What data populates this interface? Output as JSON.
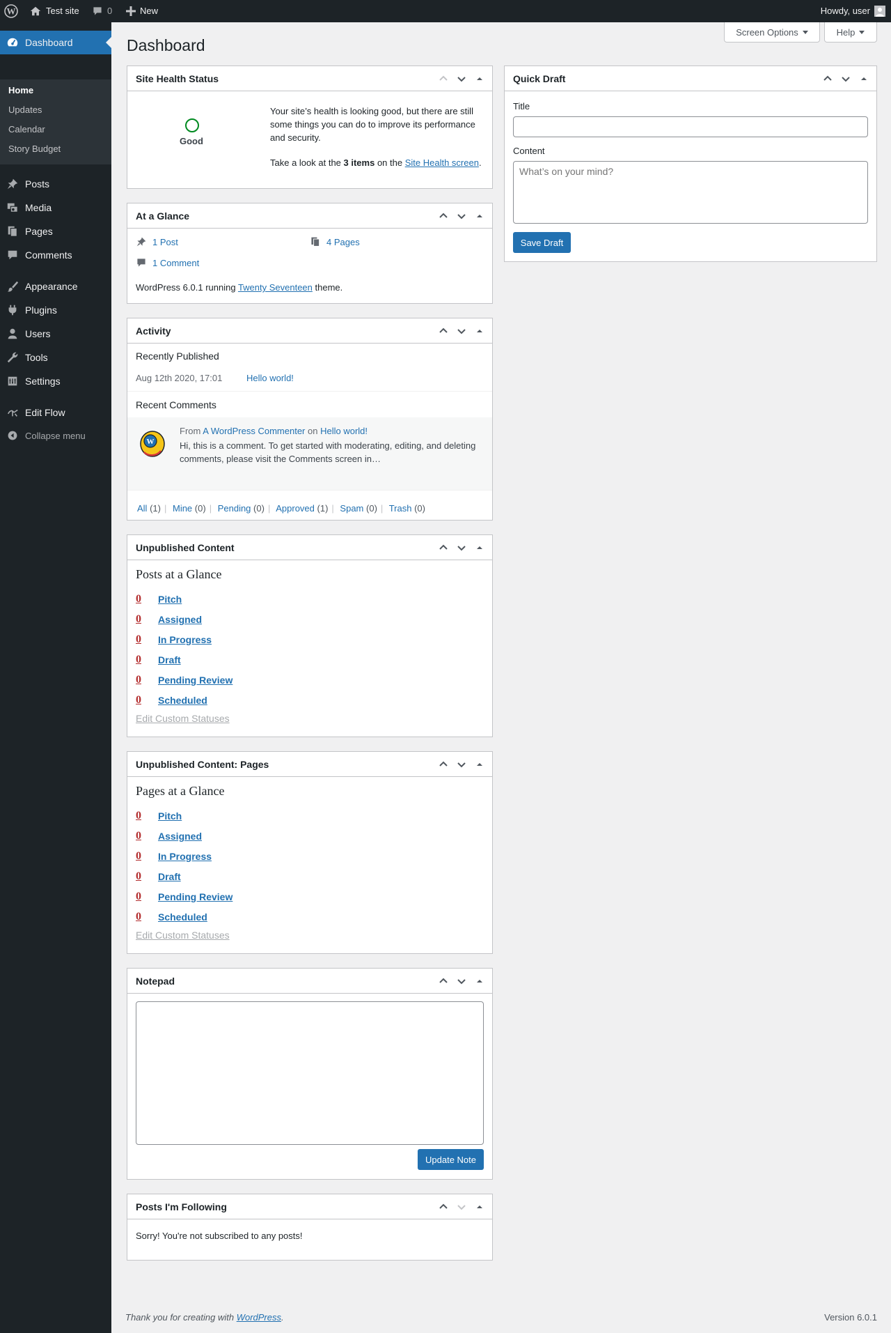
{
  "adminbar": {
    "site_name": "Test site",
    "comments_count": "0",
    "new_label": "New",
    "howdy": "Howdy, user"
  },
  "sidebar": {
    "dashboard": "Dashboard",
    "submenu": [
      "Home",
      "Updates",
      "Calendar",
      "Story Budget"
    ],
    "items": [
      "Posts",
      "Media",
      "Pages",
      "Comments",
      "Appearance",
      "Plugins",
      "Users",
      "Tools",
      "Settings",
      "Edit Flow"
    ],
    "collapse": "Collapse menu"
  },
  "header": {
    "title": "Dashboard",
    "screen_options": "Screen Options",
    "help": "Help"
  },
  "site_health": {
    "title": "Site Health Status",
    "status": "Good",
    "message": "Your site’s health is looking good, but there are still some things you can do to improve its performance and security.",
    "look_pre": "Take a look at the ",
    "items": "3 items",
    "look_mid": " on the ",
    "link": "Site Health screen",
    "look_post": "."
  },
  "at_a_glance": {
    "title": "At a Glance",
    "posts": "1 Post",
    "pages": "4 Pages",
    "comments": "1 Comment",
    "wp_pre": "WordPress 6.0.1 running ",
    "theme": "Twenty Seventeen",
    "wp_post": " theme."
  },
  "activity": {
    "title": "Activity",
    "recently_published": "Recently Published",
    "pub_date": "Aug 12th 2020, 17:01",
    "pub_title": "Hello world!",
    "recent_comments": "Recent Comments",
    "from": "From",
    "commenter": "A WordPress Commenter",
    "on": "on",
    "comment_post": "Hello world!",
    "comment_text": "Hi, this is a comment. To get started with moderating, editing, and deleting comments, please visit the Comments screen in…",
    "filters": [
      {
        "label": "All",
        "count": "(1)"
      },
      {
        "label": "Mine",
        "count": "(0)"
      },
      {
        "label": "Pending",
        "count": "(0)"
      },
      {
        "label": "Approved",
        "count": "(1)"
      },
      {
        "label": "Spam",
        "count": "(0)"
      },
      {
        "label": "Trash",
        "count": "(0)"
      }
    ]
  },
  "unpublished_posts": {
    "title": "Unpublished Content",
    "heading": "Posts at a Glance",
    "rows": [
      {
        "count": "0",
        "label": "Pitch"
      },
      {
        "count": "0",
        "label": "Assigned"
      },
      {
        "count": "0",
        "label": "In Progress"
      },
      {
        "count": "0",
        "label": "Draft"
      },
      {
        "count": "0",
        "label": "Pending Review"
      },
      {
        "count": "0",
        "label": "Scheduled"
      }
    ],
    "edit": "Edit Custom Statuses"
  },
  "unpublished_pages": {
    "title": "Unpublished Content: Pages",
    "heading": "Pages at a Glance",
    "rows": [
      {
        "count": "0",
        "label": "Pitch"
      },
      {
        "count": "0",
        "label": "Assigned"
      },
      {
        "count": "0",
        "label": "In Progress"
      },
      {
        "count": "0",
        "label": "Draft"
      },
      {
        "count": "0",
        "label": "Pending Review"
      },
      {
        "count": "0",
        "label": "Scheduled"
      }
    ],
    "edit": "Edit Custom Statuses"
  },
  "notepad": {
    "title": "Notepad",
    "value": "",
    "button": "Update Note"
  },
  "following": {
    "title": "Posts I'm Following",
    "message": "Sorry! You're not subscribed to any posts!"
  },
  "quick_draft": {
    "title": "Quick Draft",
    "title_label": "Title",
    "title_value": "",
    "content_label": "Content",
    "content_placeholder": "What’s on your mind?",
    "button": "Save Draft"
  },
  "footer": {
    "thanks_pre": "Thank you for creating with ",
    "wordpress": "WordPress",
    "thanks_post": ".",
    "version": "Version 6.0.1"
  },
  "colors": {
    "primary": "#2271b1",
    "adminbar": "#1d2327",
    "good": "#008a20",
    "count_red": "#b32d2e"
  }
}
